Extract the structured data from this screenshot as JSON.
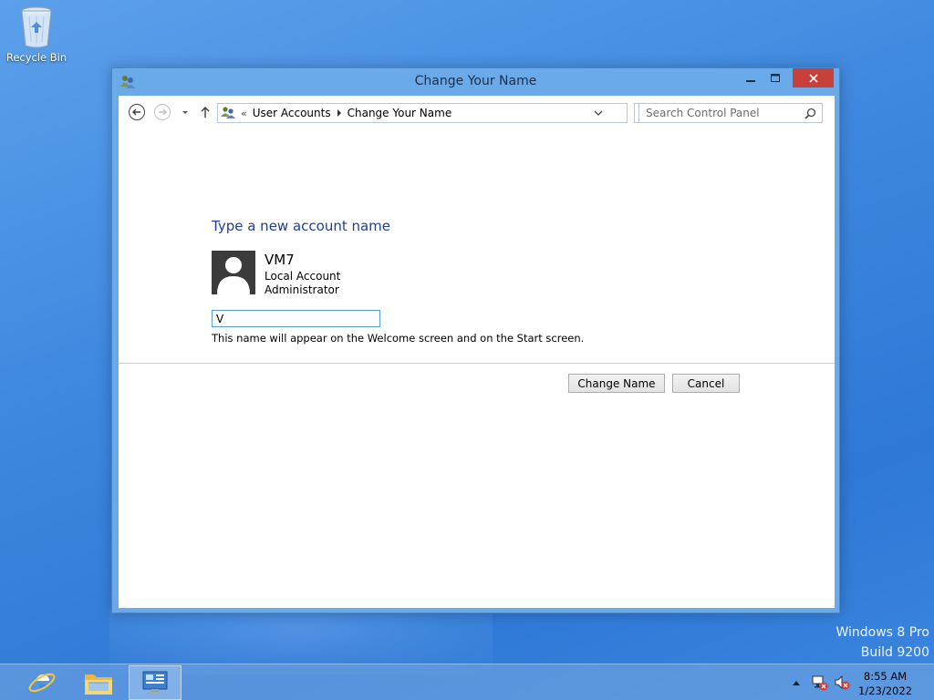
{
  "desktop": {
    "recycle_bin_label": "Recycle Bin",
    "watermark_line1": "Windows 8 Pro",
    "watermark_line2": "Build 9200"
  },
  "window": {
    "title": "Change Your Name",
    "breadcrumb_prefix": "«",
    "breadcrumb": [
      "User Accounts",
      "Change Your Name"
    ],
    "search_placeholder": "Search Control Panel"
  },
  "content": {
    "heading": "Type a new account name",
    "account": {
      "name": "VM7",
      "type": "Local Account",
      "role": "Administrator"
    },
    "name_input_value": "V",
    "hint": "This name will appear on the Welcome screen and on the Start screen.",
    "change_button": "Change Name",
    "cancel_button": "Cancel"
  },
  "taskbar": {
    "items": [
      "internet-explorer",
      "file-explorer",
      "control-panel"
    ],
    "active_item": "control-panel",
    "time": "8:55 AM",
    "date": "1/23/2022"
  },
  "colors": {
    "accent": "#1e3f8f",
    "close_button": "#c8403a",
    "window_frame": "#6aaae8"
  }
}
